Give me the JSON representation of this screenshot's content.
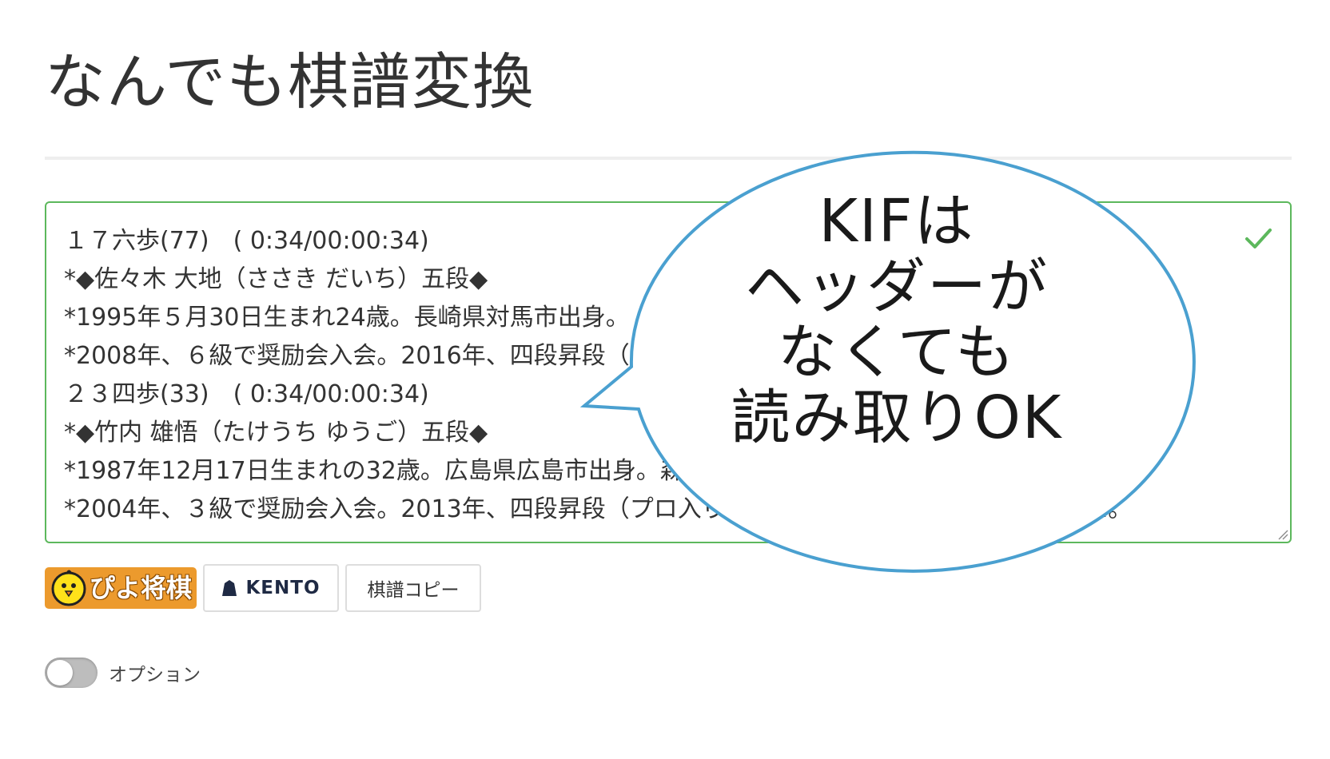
{
  "header": {
    "title": "なんでも棋譜変換"
  },
  "kifu_input": {
    "lines": [
      "１７六歩(77)　( 0:34/00:00:34)",
      "*◆佐々木 大地（ささき だいち）五段◆",
      "*1995年５月30日生まれ24歳。長崎県対馬市出身。",
      "*2008年、６級で奨励会入会。2016年、四段昇段（プロ入り）。2019年、五段。棋士番号は306。",
      "２３四歩(33)　( 0:34/00:00:34)",
      "*◆竹内 雄悟（たけうち ゆうご）五段◆",
      "*1987年12月17日生まれの32歳。広島県広島市出身。森",
      "*2004年、３級で奨励会入会。2013年、四段昇段（プロ入り）。2019年、五段。棋士番号は292。"
    ],
    "valid": true,
    "status_color": "#5cb85c"
  },
  "buttons": {
    "piyo_label": "ぴよ将棋",
    "kento_label": "KENTO",
    "copy_label": "棋譜コピー"
  },
  "option": {
    "label": "オプション",
    "enabled": false
  },
  "callout": {
    "lines": [
      "KIFは",
      "ヘッダーが",
      "なくても",
      "読み取りOK"
    ],
    "border_color": "#4aa0d0"
  }
}
